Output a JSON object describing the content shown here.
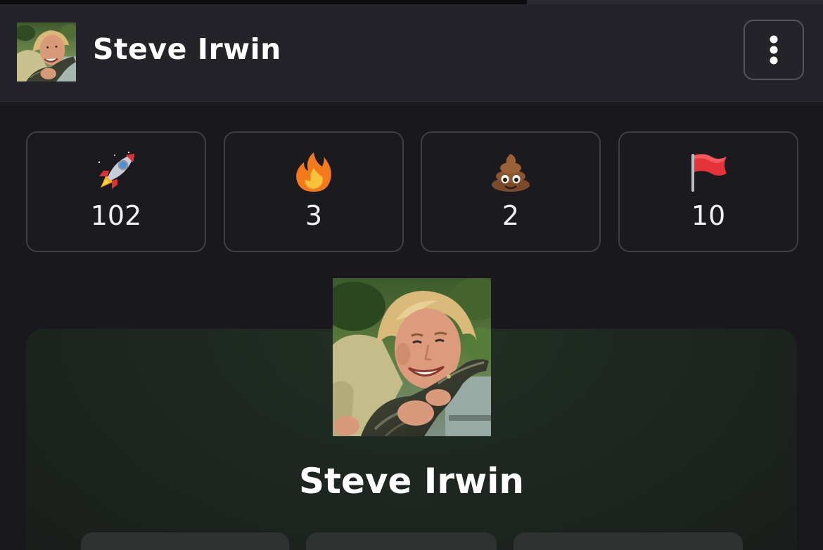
{
  "header": {
    "title": "Steve Irwin",
    "avatar_icon": "profile-photo",
    "menu_icon": "more-vertical-icon"
  },
  "progress": {
    "fraction": 0.64
  },
  "stats": [
    {
      "icon": "rocket-icon",
      "value": "102"
    },
    {
      "icon": "fire-icon",
      "value": "3"
    },
    {
      "icon": "poop-icon",
      "value": "2"
    },
    {
      "icon": "red-flag-icon",
      "value": "10"
    }
  ],
  "profile": {
    "name": "Steve Irwin",
    "photo_icon": "profile-photo"
  },
  "colors": {
    "background": "#19181d",
    "header": "#242329",
    "card_border": "#3f3e44",
    "panel_green": "#233024"
  }
}
